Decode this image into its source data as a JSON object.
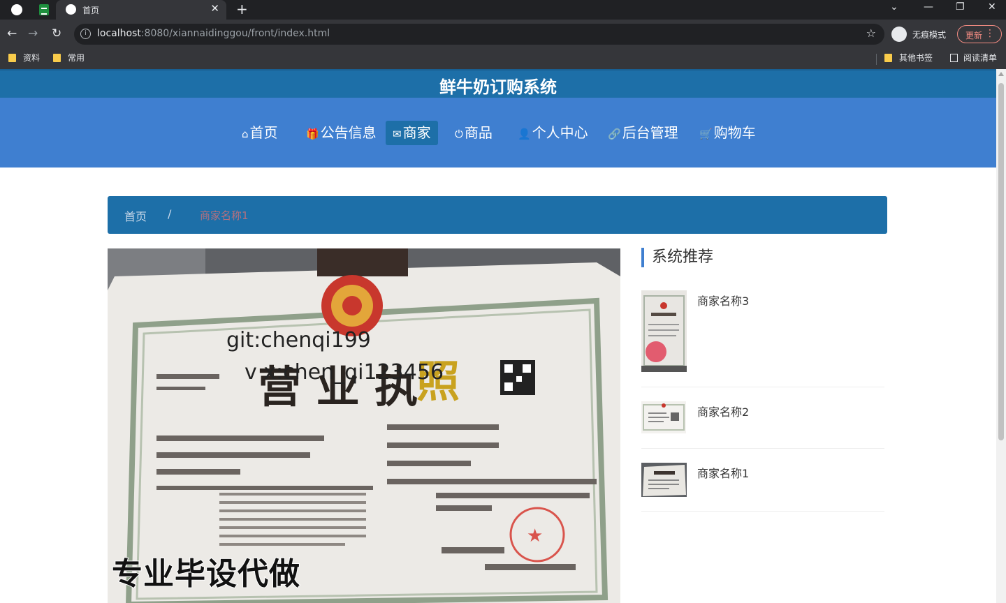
{
  "browser": {
    "tab_title": "首页",
    "close_glyph": "✕",
    "new_tab_glyph": "+",
    "url_host": "localhost",
    "url_rest": ":8080/xiannaidinggou/front/index.html",
    "incognito_label": "无痕模式",
    "update_label": "更新",
    "bookmarks": [
      "资料",
      "常用"
    ],
    "bookmarks_right": [
      "其他书签",
      "阅读清单"
    ]
  },
  "site": {
    "title": "鲜牛奶订购系统",
    "accent_color": "#1d6fa8",
    "nav_color": "#3f7fd0",
    "nav": [
      {
        "icon": "home-icon",
        "glyph": "⌂",
        "label": "首页"
      },
      {
        "icon": "gift-icon",
        "glyph": "🎁",
        "label": "公告信息"
      },
      {
        "icon": "mail-icon",
        "glyph": "✉",
        "label": "商家"
      },
      {
        "icon": "power-icon",
        "glyph": "⏻",
        "label": "商品"
      },
      {
        "icon": "user-icon",
        "glyph": "👤",
        "label": "个人中心"
      },
      {
        "icon": "link-icon",
        "glyph": "🔗",
        "label": "后台管理"
      },
      {
        "icon": "cart-icon",
        "glyph": "🛒",
        "label": "购物车"
      }
    ],
    "active_nav": "商家"
  },
  "breadcrumb": {
    "home": "首页",
    "separator": "/",
    "current": "商家名称1"
  },
  "main_image": {
    "watermark_1": "git:chenqi199",
    "watermark_2": "v x:chen_qi123456",
    "watermark_3": "专业毕设代做",
    "document_heading": "营业执照"
  },
  "recommend": {
    "title": "系统推荐",
    "items": [
      {
        "name": "商家名称3"
      },
      {
        "name": "商家名称2"
      },
      {
        "name": "商家名称1"
      }
    ]
  }
}
